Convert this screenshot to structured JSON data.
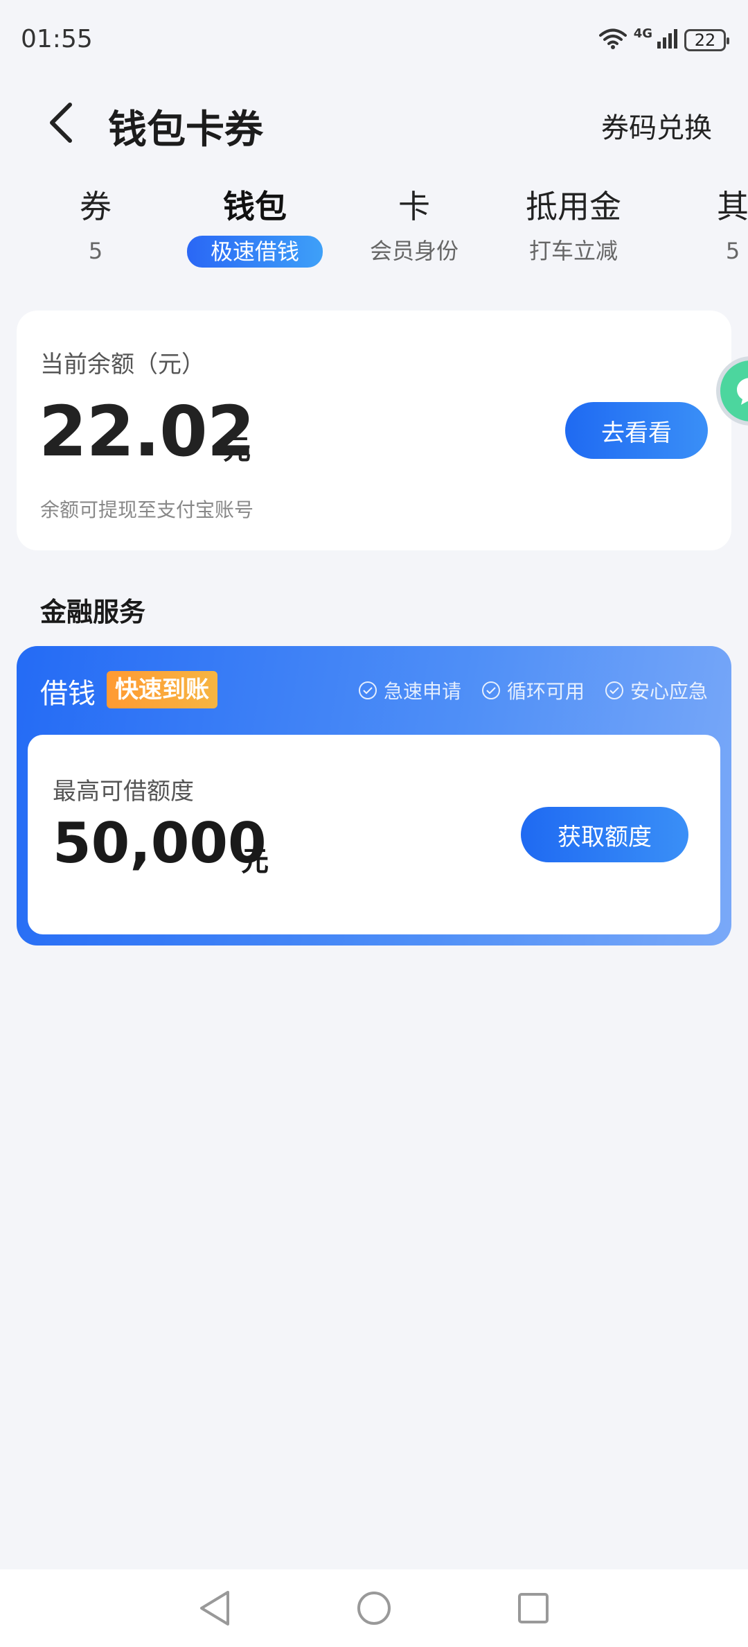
{
  "status_bar": {
    "time": "01:55",
    "network": "4G",
    "battery": "22"
  },
  "header": {
    "title": "钱包卡券",
    "redeem_label": "券码兑换"
  },
  "tabs": [
    {
      "label": "券",
      "sub": "5"
    },
    {
      "label": "钱包",
      "sub": "极速借钱",
      "active": true
    },
    {
      "label": "卡",
      "sub": "会员身份"
    },
    {
      "label": "抵用金",
      "sub": "打车立减"
    },
    {
      "label": "其",
      "sub": "5"
    }
  ],
  "balance": {
    "label": "当前余额（元）",
    "amount": "22.02",
    "unit": "元",
    "note": "余额可提现至支付宝账号",
    "button": "去看看"
  },
  "finance": {
    "section_title": "金融服务",
    "card_title": "借钱",
    "badge": "快速到账",
    "features": [
      "急速申请",
      "循环可用",
      "安心应急"
    ],
    "loan_label": "最高可借额度",
    "loan_amount": "50,000",
    "loan_unit": "元",
    "button": "获取额度"
  },
  "colors": {
    "accent": "#2a6bf5",
    "badge": "#ff9a33",
    "background": "#f4f5f9"
  }
}
